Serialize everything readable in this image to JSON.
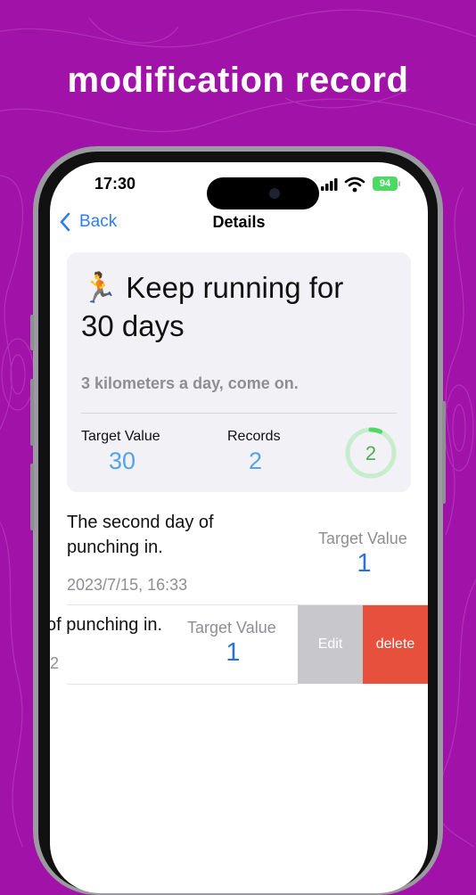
{
  "headline": "modification record",
  "status": {
    "time": "17:30",
    "battery": "94"
  },
  "nav": {
    "back_label": "Back",
    "title": "Details"
  },
  "goal": {
    "emoji": "🏃",
    "title": "Keep running for 30 days",
    "description": "3 kilometers a day, come on.",
    "target_label": "Target Value",
    "target_value": "30",
    "records_label": "Records",
    "records_value": "2",
    "ring_value": "2",
    "progress": 0.067
  },
  "records": [
    {
      "title": "The second day of punching in.",
      "date": "2023/7/15, 16:33",
      "target_label": "Target Value",
      "target_value": "1"
    },
    {
      "title": "of punching in.",
      "date": "2",
      "target_label": "Target Value",
      "target_value": "1"
    }
  ],
  "swipe_actions": {
    "edit_label": "Edit",
    "delete_label": "delete"
  },
  "colors": {
    "background": "#a112a8",
    "accent": "#2f7cf6",
    "ring": "#4cd964",
    "delete": "#e8503e",
    "edit": "#c7c7cc"
  }
}
